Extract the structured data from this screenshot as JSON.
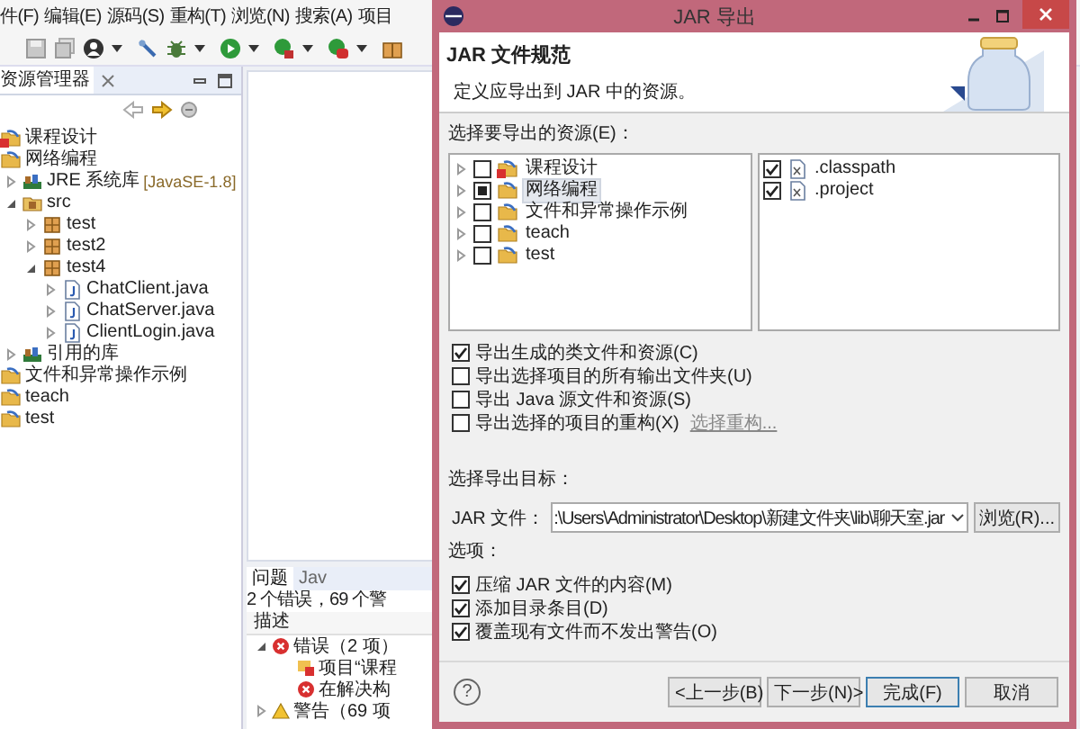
{
  "menu": [
    "件(F)",
    "编辑(E)",
    "源码(S)",
    "重构(T)",
    "浏览(N)",
    "搜索(A)",
    "项目"
  ],
  "explorer": {
    "title": "资源管理器",
    "tree": [
      {
        "label": "课程设计",
        "kind": "project",
        "error": true
      },
      {
        "label": "网络编程",
        "kind": "project",
        "children": [
          {
            "label": "JRE 系统库",
            "decoration": "[JavaSE-1.8]",
            "kind": "library",
            "expanded": false
          },
          {
            "label": "src",
            "kind": "source",
            "expanded": true,
            "children": [
              {
                "label": "test",
                "kind": "package",
                "expanded": false
              },
              {
                "label": "test2",
                "kind": "package",
                "expanded": false
              },
              {
                "label": "test4",
                "kind": "package",
                "expanded": true,
                "children": [
                  {
                    "label": "ChatClient.java",
                    "kind": "java",
                    "expanded": false
                  },
                  {
                    "label": "ChatServer.java",
                    "kind": "java",
                    "expanded": false
                  },
                  {
                    "label": "ClientLogin.java",
                    "kind": "java",
                    "expanded": false
                  }
                ]
              }
            ]
          },
          {
            "label": "引用的库",
            "kind": "library",
            "expanded": false
          }
        ]
      },
      {
        "label": "文件和异常操作示例",
        "kind": "project"
      },
      {
        "label": "teach",
        "kind": "project"
      },
      {
        "label": "test",
        "kind": "project"
      }
    ]
  },
  "problems": {
    "tabs": [
      {
        "label": "问题",
        "selected": true
      },
      {
        "label": "Jav",
        "selected": false
      }
    ],
    "summary": "2 个错误，69 个警",
    "column": "描述",
    "rows": [
      {
        "label": "错误（2 项）",
        "kind": "error-group",
        "expanded": true,
        "children": [
          {
            "label": "项目“课程",
            "kind": "project-error"
          },
          {
            "label": "在解决构",
            "kind": "error"
          }
        ]
      },
      {
        "label": "警告（69 项",
        "kind": "warning-group",
        "expanded": false
      }
    ]
  },
  "dialog": {
    "title": "JAR 导出",
    "heading": "JAR 文件规范",
    "description": "定义应导出到 JAR 中的资源。",
    "resources_label": "选择要导出的资源(E)：",
    "resources": [
      {
        "label": "课程设计",
        "checked": false,
        "partial": false,
        "error": true,
        "selected": false
      },
      {
        "label": "网络编程",
        "checked": false,
        "partial": true,
        "selected": true
      },
      {
        "label": "文件和异常操作示例",
        "checked": false,
        "partial": false,
        "selected": false
      },
      {
        "label": "teach",
        "checked": false,
        "partial": false,
        "selected": false
      },
      {
        "label": "test",
        "checked": false,
        "partial": false,
        "selected": false
      }
    ],
    "files": [
      {
        "label": ".classpath",
        "checked": true
      },
      {
        "label": ".project",
        "checked": true
      }
    ],
    "export_options": [
      {
        "label": "导出生成的类文件和资源(C)",
        "checked": true
      },
      {
        "label": "导出选择项目的所有输出文件夹(U)",
        "checked": false
      },
      {
        "label": "导出 Java 源文件和资源(S)",
        "checked": false
      },
      {
        "label": "导出选择的项目的重构(X)",
        "checked": false,
        "link": "选择重构..."
      }
    ],
    "target_label": "选择导出目标：",
    "jar_label": "JAR 文件：",
    "jar_path": ":\\Users\\Administrator\\Desktop\\新建文件夹\\lib\\聊天室.jar",
    "browse": "浏览(R)...",
    "options_label": "选项：",
    "options": [
      {
        "label": "压缩 JAR 文件的内容(M)",
        "checked": true
      },
      {
        "label": "添加目录条目(D)",
        "checked": true
      },
      {
        "label": "覆盖现有文件而不发出警告(O)",
        "checked": true
      }
    ],
    "help": "?",
    "buttons": [
      {
        "label": "<上一步(B)",
        "default": false
      },
      {
        "label": "下一步(N)>",
        "default": false
      },
      {
        "label": "完成(F)",
        "default": true
      },
      {
        "label": "取消",
        "default": false
      }
    ]
  }
}
